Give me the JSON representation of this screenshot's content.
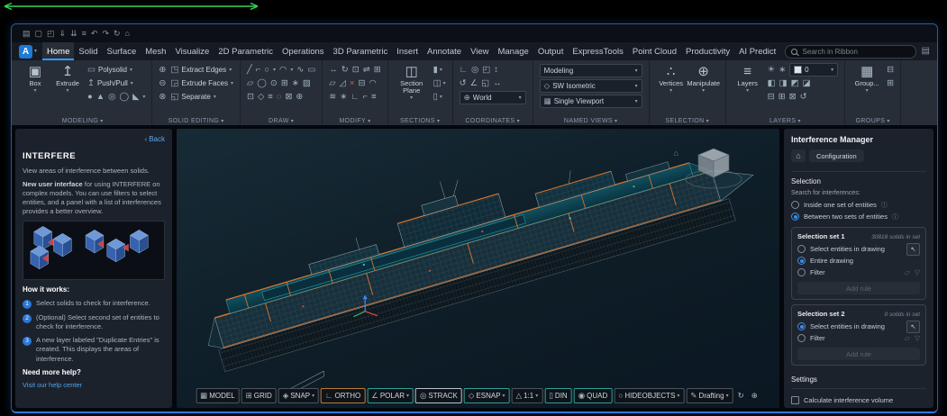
{
  "ui": {
    "caret": "▾",
    "info": "ⓘ",
    "chevron_left": "‹",
    "pick": "↖",
    "folder": "▱",
    "funnel": "▽",
    "home": "⌂",
    "panel_toggle": "▤"
  },
  "window": {
    "logo_letter": "A",
    "qat": [
      {
        "name": "app-grid-icon",
        "glyph": "▤"
      },
      {
        "name": "new-file-icon",
        "glyph": "▢"
      },
      {
        "name": "open-file-icon",
        "glyph": "◰"
      },
      {
        "name": "save-icon",
        "glyph": "⇓"
      },
      {
        "name": "save-all-icon",
        "glyph": "⇊"
      },
      {
        "name": "print-icon",
        "glyph": "≡"
      },
      {
        "name": "undo-icon",
        "glyph": "↶"
      },
      {
        "name": "redo-icon",
        "glyph": "↷"
      },
      {
        "name": "refresh-icon",
        "glyph": "↻"
      },
      {
        "name": "home-icon",
        "glyph": "⌂"
      }
    ]
  },
  "ribbon": {
    "search_placeholder": "Search in Ribbon",
    "tabs": [
      {
        "label": "Home",
        "active": true
      },
      {
        "label": "Solid",
        "active": false
      },
      {
        "label": "Surface",
        "active": false
      },
      {
        "label": "Mesh",
        "active": false
      },
      {
        "label": "Visualize",
        "active": false
      },
      {
        "label": "2D Parametric",
        "active": false
      },
      {
        "label": "Operations",
        "active": false
      },
      {
        "label": "3D Parametric",
        "active": false
      },
      {
        "label": "Insert",
        "active": false
      },
      {
        "label": "Annotate",
        "active": false
      },
      {
        "label": "View",
        "active": false
      },
      {
        "label": "Manage",
        "active": false
      },
      {
        "label": "Output",
        "active": false
      },
      {
        "label": "ExpressTools",
        "active": false
      },
      {
        "label": "Point Cloud",
        "active": false
      },
      {
        "label": "Productivity",
        "active": false
      },
      {
        "label": "AI Predict",
        "active": false
      }
    ],
    "groups": {
      "modeling": {
        "label": "MODELING",
        "big": [
          {
            "name": "box",
            "label": "Box",
            "glyph": "▣"
          },
          {
            "name": "extrude",
            "label": "Extrude",
            "glyph": "↥"
          }
        ],
        "rows": [
          {
            "name": "polysolid",
            "label": "Polysolid",
            "glyph": "▭"
          },
          {
            "name": "push-pull",
            "label": "Push/Pull",
            "glyph": "↥"
          }
        ],
        "prims": [
          {
            "name": "sphere-icon",
            "glyph": "●"
          },
          {
            "name": "cone-icon",
            "glyph": "▲"
          },
          {
            "name": "cylinder-icon",
            "glyph": "◎"
          },
          {
            "name": "torus-icon",
            "glyph": "◯"
          },
          {
            "name": "wedge-icon",
            "glyph": "◣",
            "caret": true
          }
        ]
      },
      "solid_editing": {
        "label": "SOLID EDITING",
        "left": [
          {
            "name": "union-icon",
            "glyph": "⊕"
          },
          {
            "name": "subtract-icon",
            "glyph": "⊖"
          },
          {
            "name": "intersect-icon",
            "glyph": "⊗"
          }
        ],
        "rows": [
          {
            "icon_name": "extract-edges-icon",
            "glyph": "◳",
            "label": "Extract Edges"
          },
          {
            "icon_name": "extrude-faces-icon",
            "glyph": "◲",
            "label": "Extrude Faces"
          },
          {
            "icon_name": "separate-icon",
            "glyph": "◱",
            "label": "Separate"
          }
        ]
      },
      "draw": {
        "label": "DRAW",
        "grid": [
          [
            {
              "name": "line-icon",
              "glyph": "╱"
            },
            {
              "name": "polyline-icon",
              "glyph": "⌐"
            },
            {
              "name": "circle-icon",
              "glyph": "○",
              "caret": true
            },
            {
              "name": "arc-icon",
              "glyph": "◠",
              "caret": true
            },
            {
              "name": "spline-icon",
              "glyph": "∿"
            },
            {
              "name": "rectangle-icon",
              "glyph": "▭"
            }
          ],
          [
            {
              "name": "polygon-icon",
              "glyph": "▱"
            },
            {
              "name": "ellipse-icon",
              "glyph": "◯"
            },
            {
              "name": "donut-icon",
              "glyph": "⊙"
            },
            {
              "name": "table-icon",
              "glyph": "⊞"
            },
            {
              "name": "point-icon",
              "glyph": "∗"
            },
            {
              "name": "hatch-icon",
              "glyph": "▨"
            }
          ],
          [
            {
              "name": "boundary-icon",
              "glyph": "⊡"
            },
            {
              "name": "region-icon",
              "glyph": "◇"
            },
            {
              "name": "multiline-icon",
              "glyph": "≡"
            },
            {
              "name": "revcloud-icon",
              "glyph": "◌"
            },
            {
              "name": "wipeout-icon",
              "glyph": "⊠"
            },
            {
              "name": "centerline-icon",
              "glyph": "⊕"
            }
          ]
        ]
      },
      "modify": {
        "label": "MODIFY",
        "grid": [
          [
            {
              "name": "move-icon",
              "glyph": "↔"
            },
            {
              "name": "rotate-icon",
              "glyph": "↻"
            },
            {
              "name": "copy-icon",
              "glyph": "⊡"
            },
            {
              "name": "mirror-icon",
              "glyph": "⇌"
            },
            {
              "name": "array-icon",
              "glyph": "⊞"
            }
          ],
          [
            {
              "name": "stretch-icon",
              "glyph": "▱"
            },
            {
              "name": "scale-icon",
              "glyph": "◿"
            },
            {
              "name": "erase-icon",
              "glyph": "×",
              "red": true
            },
            {
              "name": "trim-icon",
              "glyph": "⊟"
            },
            {
              "name": "fillet-icon",
              "glyph": "◠"
            }
          ],
          [
            {
              "name": "offset-icon",
              "glyph": "≋"
            },
            {
              "name": "explode-icon",
              "glyph": "∗"
            },
            {
              "name": "chamfer-icon",
              "glyph": "∟"
            },
            {
              "name": "join-icon",
              "glyph": "⌐"
            },
            {
              "name": "align-icon",
              "glyph": "≡"
            }
          ]
        ]
      },
      "sections": {
        "label": "SECTIONS",
        "big": {
          "name": "section-plane",
          "label": "Section Plane",
          "glyph": "◫"
        },
        "side": [
          {
            "name": "live-section-icon",
            "glyph": "▮"
          },
          {
            "name": "section-block-icon",
            "glyph": "◫"
          },
          {
            "name": "section-settings-icon",
            "glyph": "▯"
          }
        ]
      },
      "coordinates": {
        "label": "COORDINATES",
        "rows": [
          [
            {
              "name": "ucs-icon",
              "glyph": "∟"
            },
            {
              "name": "ucs-origin-icon",
              "glyph": "◎"
            },
            {
              "name": "ucs-face-icon",
              "glyph": "◰"
            },
            {
              "name": "ucs-z-axis-icon",
              "glyph": "↕"
            }
          ],
          [
            {
              "name": "ucs-previous-icon",
              "glyph": "↺"
            },
            {
              "name": "ucs-3point-icon",
              "glyph": "∠"
            },
            {
              "name": "ucs-object-icon",
              "glyph": "◱"
            },
            {
              "name": "ucs-world-icon",
              "glyph": "↔"
            }
          ]
        ],
        "dropdown": {
          "name": "ucs-select",
          "glyph": "⊕",
          "value": "World"
        }
      },
      "named_views": {
        "label": "NAMED VIEWS",
        "dropdowns": [
          {
            "name": "view-mode-select",
            "glyph": "",
            "value": "Modeling"
          },
          {
            "name": "view-preset-select",
            "glyph": "◇",
            "value": "SW Isometric"
          },
          {
            "name": "viewport-config-select",
            "glyph": "▦",
            "value": "Single Viewport"
          }
        ]
      },
      "selection": {
        "label": "SELECTION",
        "big": [
          {
            "name": "vertices",
            "label": "Vertices",
            "glyph": "∴"
          },
          {
            "name": "manipulate",
            "label": "Manipulate",
            "glyph": "⊕"
          }
        ]
      },
      "layers": {
        "label": "LAYERS",
        "big": {
          "name": "layers",
          "label": "Layers",
          "glyph": "≡"
        },
        "row1_icons": [
          {
            "name": "layer-on-icon",
            "glyph": "☀"
          },
          {
            "name": "layer-new-icon",
            "glyph": "∗"
          }
        ],
        "dropdown": {
          "value": "0",
          "swatch": "#dfe5ea"
        },
        "row2_icons": [
          {
            "name": "layer-freeze-icon",
            "glyph": "◧"
          },
          {
            "name": "layer-lock-icon",
            "glyph": "◨"
          },
          {
            "name": "layer-isolate-icon",
            "glyph": "◩"
          },
          {
            "name": "layer-match-icon",
            "glyph": "◪"
          }
        ],
        "row3_icons": [
          {
            "name": "layer-walk-icon",
            "glyph": "⊟"
          },
          {
            "name": "layer-merge-icon",
            "glyph": "⊞"
          },
          {
            "name": "layer-delete-icon",
            "glyph": "⊠"
          },
          {
            "name": "layer-previous-icon",
            "glyph": "↺"
          }
        ]
      },
      "groups": {
        "label": "GROUPS",
        "big": {
          "name": "group",
          "label": "Group...",
          "glyph": "▦"
        },
        "side": [
          {
            "name": "ungroup-icon",
            "glyph": "⊟"
          },
          {
            "name": "group-edit-icon",
            "glyph": "⊞"
          }
        ]
      }
    }
  },
  "left_panel": {
    "back_label": "Back",
    "title": "INTERFERE",
    "intro": "View areas of interference between solids.",
    "lead_bold": "New user interface",
    "lead_rest": " for using INTERFERE on complex models. You can use filters to select entities, and a panel with a list of interferences provides a better overview.",
    "how_title": "How it works:",
    "steps": [
      "Select solids to check for interference.",
      "(Optional) Select second set of entities to check for interference.",
      "A new layer labeled \"Duplicate Entries\" is created. This displays the areas of interference."
    ],
    "help_title": "Need more help?",
    "help_link": "Visit our help center"
  },
  "right_panel": {
    "title": "Interference Manager",
    "breadcrumb": "Configuration",
    "selection_header": "Selection",
    "search_label": "Search for interferences:",
    "search_options": [
      {
        "label": "Inside one set of entities",
        "selected": false,
        "info": true
      },
      {
        "label": "Between two sets of entities",
        "selected": true,
        "info": true
      }
    ],
    "sets": [
      {
        "title": "Selection set 1",
        "count": "30818 solids in set",
        "options": [
          {
            "label": "Select entities in drawing",
            "selected": false,
            "pick": true
          },
          {
            "label": "Entire drawing",
            "selected": true
          },
          {
            "label": "Filter",
            "selected": false,
            "trail_icons": true
          }
        ],
        "add_rule": "Add rule"
      },
      {
        "title": "Selection set 2",
        "count": "0 solids in set",
        "options": [
          {
            "label": "Select entities in drawing",
            "selected": true,
            "pick": true
          },
          {
            "label": "Filter",
            "selected": false,
            "trail_icons": true
          }
        ],
        "add_rule": "Add rule"
      }
    ],
    "settings_header": "Settings",
    "settings_option": "Calculate interference volume"
  },
  "statusbar": {
    "items": [
      {
        "name": "model",
        "label": "MODEL",
        "icon": "▦",
        "accent": "none",
        "caret": false
      },
      {
        "name": "grid",
        "label": "GRID",
        "icon": "⊞",
        "accent": "none",
        "caret": false
      },
      {
        "name": "snap",
        "label": "SNAP",
        "icon": "◈",
        "accent": "none",
        "caret": true
      },
      {
        "name": "ortho",
        "label": "ORTHO",
        "icon": "∟",
        "accent": "orange",
        "caret": false
      },
      {
        "name": "polar",
        "label": "POLAR",
        "icon": "∠",
        "accent": "teal",
        "caret": true
      },
      {
        "name": "strack",
        "label": "STRACK",
        "icon": "◎",
        "accent": "white",
        "caret": false
      },
      {
        "name": "esnap",
        "label": "ESNAP",
        "icon": "◇",
        "accent": "teal",
        "caret": true
      },
      {
        "name": "annotation-scale",
        "label": "1:1",
        "icon": "△",
        "accent": "none",
        "caret": true
      },
      {
        "name": "din",
        "label": "DIN",
        "icon": "▯",
        "accent": "teal",
        "caret": false
      },
      {
        "name": "quad",
        "label": "QUAD",
        "icon": "◉",
        "accent": "teal",
        "caret": false
      },
      {
        "name": "hideobjects",
        "label": "HIDEOBJECTS",
        "icon": "○",
        "accent": "none",
        "caret": true
      },
      {
        "name": "workspace-drafting",
        "label": "Drafting",
        "icon": "✎",
        "accent": "none",
        "caret": true
      },
      {
        "name": "sync",
        "label": "",
        "icon": "↻",
        "accent": "bare",
        "caret": false
      },
      {
        "name": "crosshair",
        "label": "",
        "icon": "⊕",
        "accent": "bare",
        "caret": false
      }
    ]
  }
}
